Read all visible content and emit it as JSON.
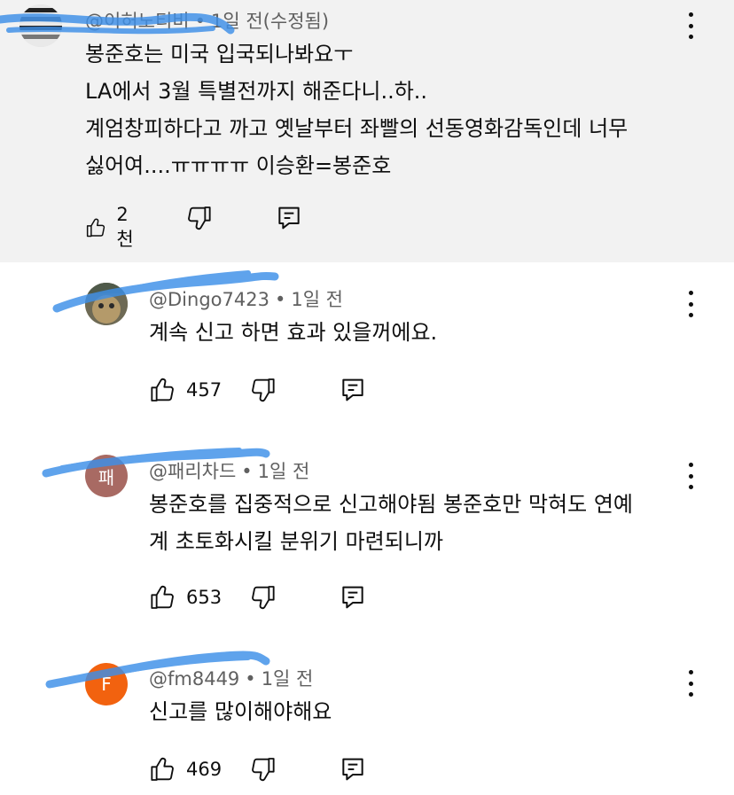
{
  "comments": [
    {
      "handle": "@이허노티비",
      "time": "1일 전(수정됨)",
      "lines": [
        "봉준호는 미국 입국되나봐요ㅜ",
        "LA에서 3월 특별전까지 해준다니..하..",
        "계엄창피하다고 까고 옛날부터 좌빨의 선동영화감독인데 너무",
        "싫어여....ㅠㅠㅠㅠ 이승환=봉준호"
      ],
      "likes": "2천",
      "highlighted": true
    },
    {
      "handle": "@Dingo7423",
      "time": "1일 전",
      "lines": [
        "계속 신고 하면 효과 있을꺼에요."
      ],
      "likes": "457"
    },
    {
      "handle": "@패리차드",
      "time": "1일 전",
      "avatar_letter": "패",
      "lines": [
        "봉준호를 집중적으로 신고해야됨 봉준호만 막혀도 연예",
        "계 초토화시킬 분위기 마련되니까"
      ],
      "likes": "653"
    },
    {
      "handle": "@fm8449",
      "time": "1일 전",
      "avatar_letter": "F",
      "lines": [
        "신고를 많이해야해요"
      ],
      "likes": "469"
    }
  ],
  "icons": {
    "like": "thumbs-up-icon",
    "dislike": "thumbs-down-icon",
    "reply": "reply-icon",
    "more": "more-vertical-icon"
  },
  "colors": {
    "highlight_bg": "#f2f2f2",
    "meta_text": "#606060",
    "avatar_p": "#a86a63",
    "avatar_f": "#f2620f",
    "redaction_scribble": "#3d8fe8"
  }
}
